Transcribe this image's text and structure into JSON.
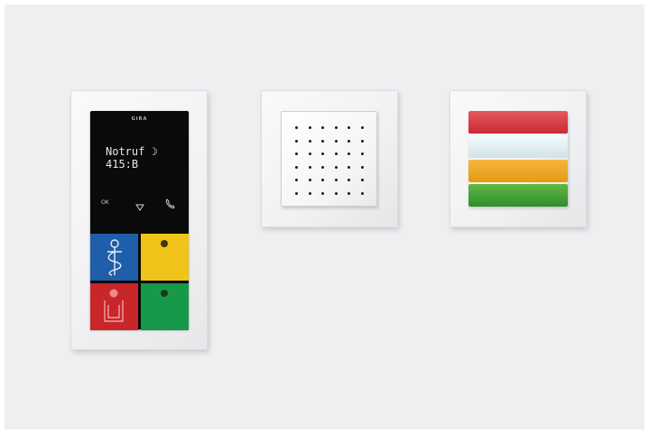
{
  "left_device": {
    "brand": "GIRA",
    "display_line1": "Notruf ☽",
    "display_line2": "415:B",
    "ok_label": "OK",
    "down_icon": "triangle-down-icon",
    "handset_icon": "phone-handset-icon",
    "keys": [
      {
        "color": "#1f5ea8",
        "icon": "caduceus-icon"
      },
      {
        "color": "#f0c319",
        "icon": "indicator-dot-icon"
      },
      {
        "color": "#c9262a",
        "icon": "person-presence-icon"
      },
      {
        "color": "#169a49",
        "icon": "indicator-dot-icon"
      }
    ]
  },
  "middle_device": {
    "type": "speaker-grille",
    "grid_rows": 6,
    "grid_cols": 6
  },
  "right_device": {
    "type": "status-light",
    "bars": [
      {
        "color": "#d9383f"
      },
      {
        "color": "#e6f4f6"
      },
      {
        "color": "#f1a928"
      },
      {
        "color": "#47a23a"
      }
    ]
  }
}
